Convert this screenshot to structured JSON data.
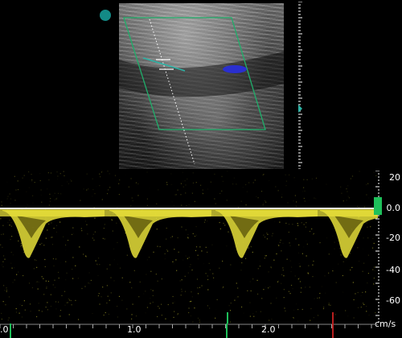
{
  "velocity_axis": {
    "ticks": [
      "20",
      "0.0",
      "-20",
      "-40",
      "-60"
    ]
  },
  "time_axis": {
    "ticks": [
      "1.0",
      "2.0"
    ],
    "left_partial": ".0"
  },
  "units_label": "cm/s",
  "colors": {
    "spectrum": "#e8e03a",
    "baseline": "#ffffff",
    "sample_box": "#1fae6a",
    "marker_dot": "#138a86",
    "flow": "#2a2fcf"
  }
}
